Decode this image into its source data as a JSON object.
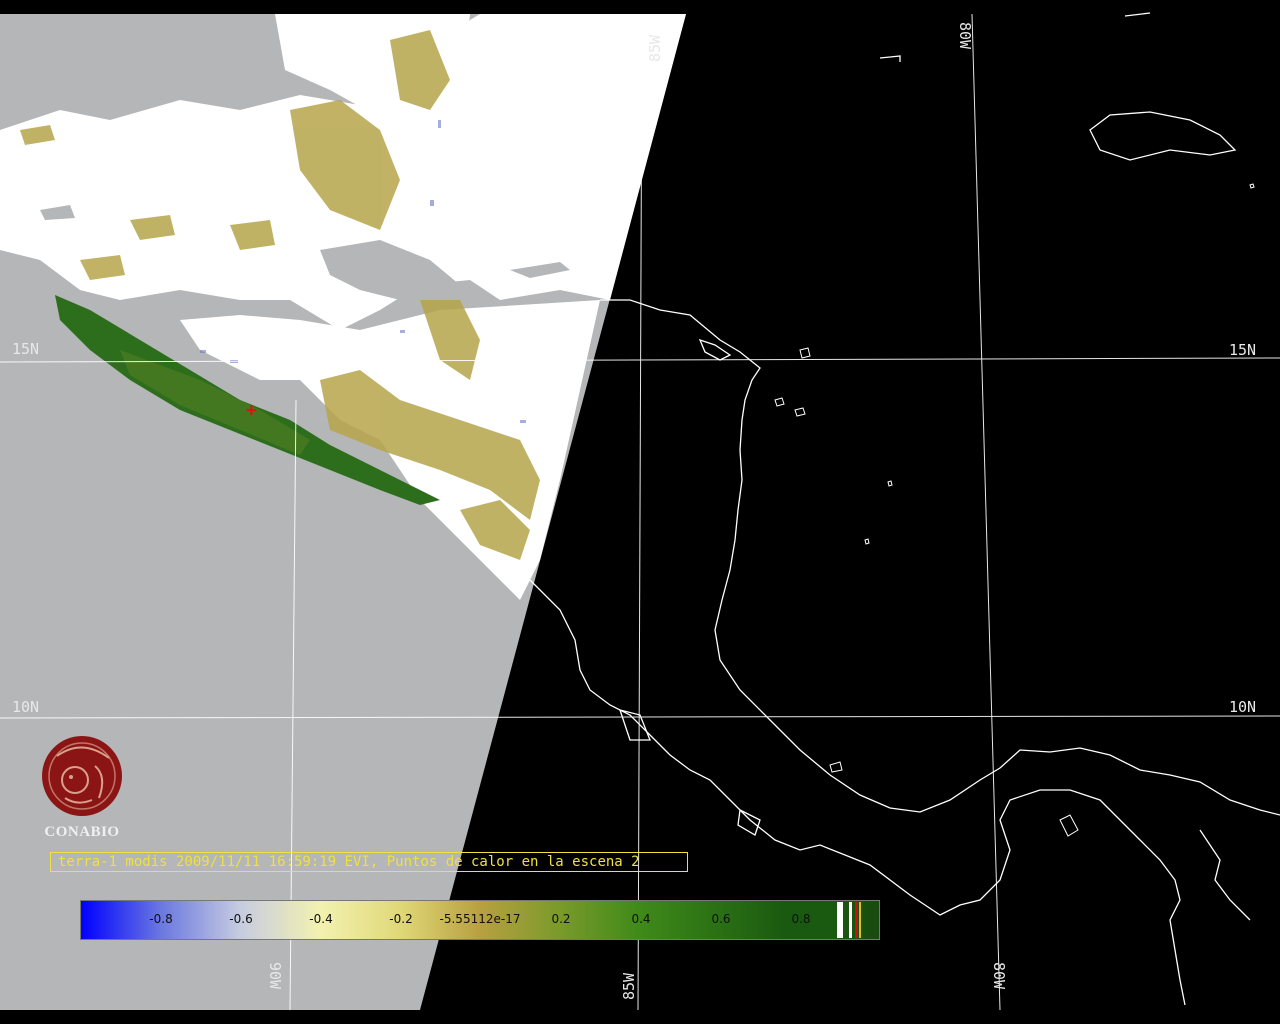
{
  "map": {
    "grid_labels": {
      "lat_15": "15N",
      "lat_10": "10N",
      "lon_85_top": "85W",
      "lon_80_top": "80W",
      "lon_90_bottom": "90W",
      "lon_85_bottom": "85W",
      "lon_80_bottom": "80W"
    },
    "fire_marker": "+"
  },
  "logo": {
    "text": "CONABIO"
  },
  "caption": {
    "text": "terra-1 modis 2009/11/11 16:59:19 EVI, Puntos de calor en la escena 2"
  },
  "colorbar": {
    "ticks": [
      "-0.8",
      "-0.6",
      "-0.4",
      "-0.2",
      "-5.55112e-17",
      "0.2",
      "0.4",
      "0.6",
      "0.8"
    ],
    "range": [
      -1,
      1
    ],
    "end_colors": [
      "#ffffff",
      "#c81010",
      "#ffffff"
    ]
  },
  "colors": {
    "swath_gray": "#b4b6b7",
    "cloud_white": "#ffffff",
    "vegetation_green": "#2d6e1c",
    "vegetation_olive": "#b6a54a",
    "coastline": "#ffffff",
    "caption_yellow": "#f0e040",
    "logo_red": "#8b1515"
  }
}
